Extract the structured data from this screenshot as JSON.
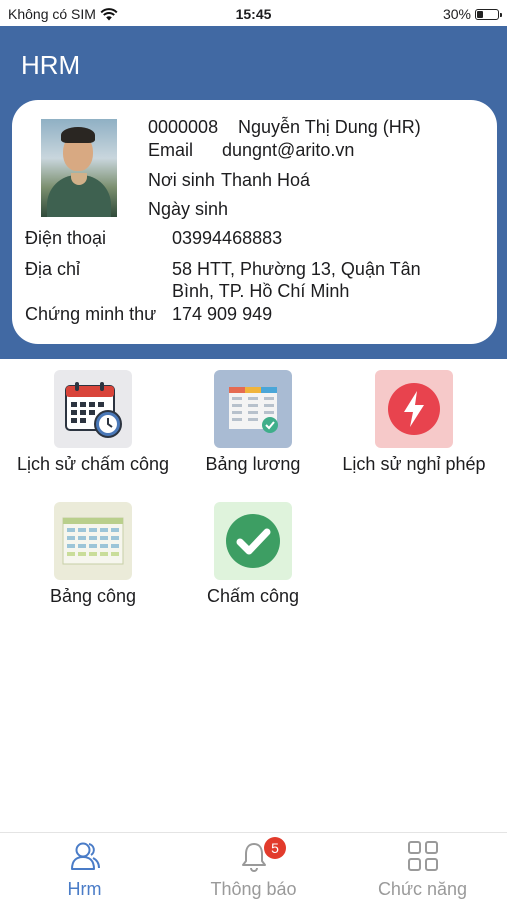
{
  "status_bar": {
    "carrier": "Không có SIM",
    "time": "15:45",
    "battery": "30%",
    "battery_level": 0.3
  },
  "header": {
    "title": "HRM"
  },
  "profile": {
    "code": "0000008",
    "name": "Nguyễn Thị Dung (HR)",
    "email_label": "Email",
    "email": "dungnt@arito.vn",
    "birthplace_label": "Nơi sinh",
    "birthplace": "Thanh Hoá",
    "birthdate_label": "Ngày sinh",
    "birthdate": "",
    "phone_label": "Điện thoại",
    "phone": "03994468883",
    "address_label": "Địa chỉ",
    "address_line1": "58 HTT, Phường 13, Quận Tân",
    "address_line2": "Bình, TP. Hồ Chí Minh",
    "id_label": "Chứng minh thư",
    "id_number": "174 909 949"
  },
  "tiles": [
    {
      "label": "Lịch sử chấm công",
      "icon": "calendar-clock-icon"
    },
    {
      "label": "Bảng lương",
      "icon": "payroll-sheet-icon"
    },
    {
      "label": "Lịch sử nghỉ phép",
      "icon": "lightning-icon"
    },
    {
      "label": "Bảng công",
      "icon": "timesheet-table-icon"
    },
    {
      "label": "Chấm công",
      "icon": "checkmark-icon"
    }
  ],
  "bottom_nav": [
    {
      "label": "Hrm",
      "icon": "people-icon",
      "active": true
    },
    {
      "label": "Thông báo",
      "icon": "bell-icon",
      "badge": "5"
    },
    {
      "label": "Chức năng",
      "icon": "grid-icon"
    }
  ],
  "colors": {
    "header_bg": "#4169a3",
    "active_tab": "#4a7cc7",
    "badge": "#e23b2c"
  }
}
